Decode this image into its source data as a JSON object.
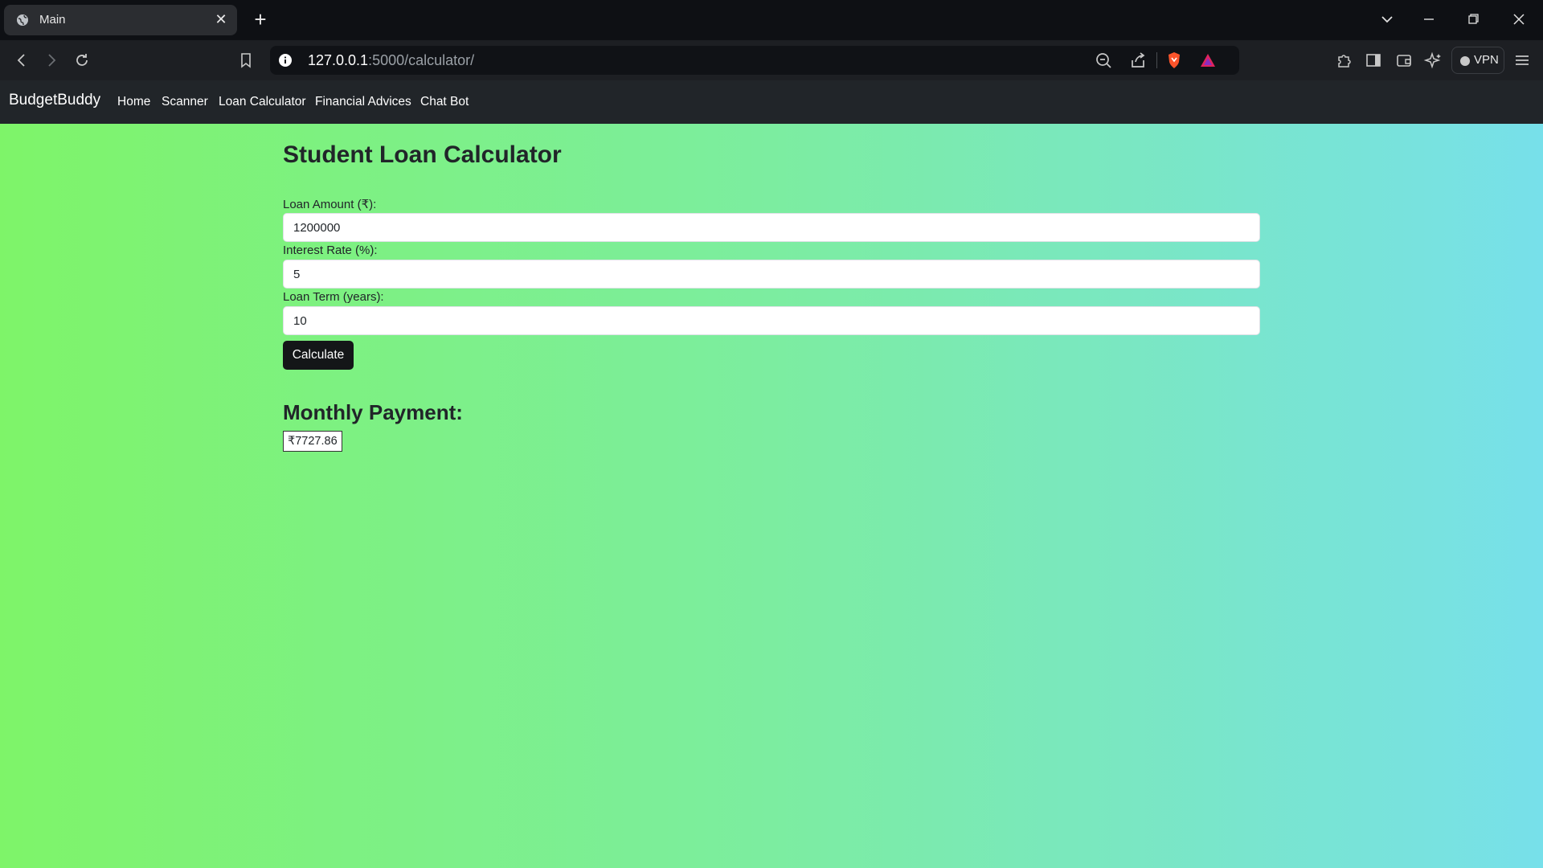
{
  "browser": {
    "tab": {
      "title": "Main"
    },
    "url": {
      "host": "127.0.0.1",
      "rest": ":5000/calculator/"
    },
    "vpn_label": "VPN",
    "icons": [
      "globe-icon",
      "close-icon",
      "plus-icon",
      "chevron-down-icon",
      "minimize-icon",
      "restore-icon",
      "window-close-icon",
      "back-icon",
      "forward-icon",
      "reload-icon",
      "bookmark-icon",
      "info-icon",
      "zoom-icon",
      "share-icon",
      "brave-shield-icon",
      "brave-rewards-icon",
      "extensions-icon",
      "sidebar-icon",
      "wallet-icon",
      "leo-ai-icon",
      "menu-icon"
    ]
  },
  "navbar": {
    "brand": "BudgetBuddy",
    "links": [
      {
        "label": "Home"
      },
      {
        "label": "Scanner"
      },
      {
        "label": "Loan Calculator"
      },
      {
        "label": "Financial Advices"
      },
      {
        "label": "Chat Bot"
      }
    ]
  },
  "calculator": {
    "title": "Student Loan Calculator",
    "fields": [
      {
        "label": "Loan Amount (₹):",
        "value": "1200000"
      },
      {
        "label": "Interest Rate (%):",
        "value": "5"
      },
      {
        "label": "Loan Term (years):",
        "value": "10"
      }
    ],
    "button_label": "Calculate",
    "result_heading": "Monthly Payment:",
    "result_value": "₹7727.86"
  },
  "colors": {
    "gradient_left": "#7ef469",
    "gradient_right": "#77e0ea",
    "navbar_bg": "#212529",
    "button_bg": "#141618"
  }
}
